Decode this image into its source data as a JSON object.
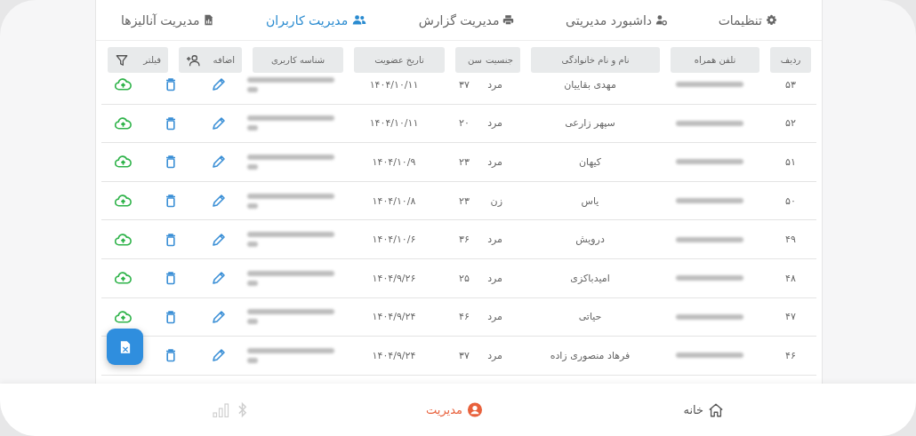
{
  "tabs": [
    {
      "label": "تنظیمات",
      "kind": "gear",
      "selected": false
    },
    {
      "label": "داشبورد مدیریتی",
      "kind": "admin",
      "selected": false
    },
    {
      "label": "مدیریت گزارش",
      "kind": "printer",
      "selected": false
    },
    {
      "label": "مدیریت کاربران",
      "kind": "users",
      "selected": true
    },
    {
      "label": "مدیریت آنالیزها",
      "kind": "chart",
      "selected": false
    }
  ],
  "table": {
    "headers": {
      "row_no": "ردیف",
      "phone": "تلفن همراه",
      "name": "نام و نام خانوادگی",
      "gender": "جنسیت",
      "age": "سن",
      "joined": "تاریخ عضویت",
      "user_id": "شناسه کاربری"
    },
    "add_button": "اضافه",
    "filter_button": "فیلتر",
    "rows": [
      {
        "row_no": "۵۳",
        "name": "مهدی بقاییان",
        "gender": "مرد",
        "age": "۳۷",
        "joined": "۱۴۰۴/۱۰/۱۱"
      },
      {
        "row_no": "۵۲",
        "name": "سپهر زارعی",
        "gender": "مرد",
        "age": "۲۰",
        "joined": "۱۴۰۴/۱۰/۱۱"
      },
      {
        "row_no": "۵۱",
        "name": "کیهان",
        "gender": "مرد",
        "age": "۲۳",
        "joined": "۱۴۰۴/۱۰/۹"
      },
      {
        "row_no": "۵۰",
        "name": "یاس",
        "gender": "زن",
        "age": "۲۳",
        "joined": "۱۴۰۴/۱۰/۸"
      },
      {
        "row_no": "۴۹",
        "name": "درویش",
        "gender": "مرد",
        "age": "۳۶",
        "joined": "۱۴۰۴/۱۰/۶"
      },
      {
        "row_no": "۴۸",
        "name": "امیدباکزی",
        "gender": "مرد",
        "age": "۲۵",
        "joined": "۱۴۰۴/۹/۲۶"
      },
      {
        "row_no": "۴۷",
        "name": "حیاتی",
        "gender": "مرد",
        "age": "۴۶",
        "joined": "۱۴۰۴/۹/۲۴"
      },
      {
        "row_no": "۴۶",
        "name": "فرهاد منصوری زاده",
        "gender": "مرد",
        "age": "۳۷",
        "joined": "۱۴۰۴/۹/۲۴"
      }
    ]
  },
  "bottom_nav": [
    {
      "label": "خانه",
      "kind": "home",
      "selected": false
    },
    {
      "label": "مدیریت",
      "kind": "profile",
      "selected": true
    }
  ]
}
